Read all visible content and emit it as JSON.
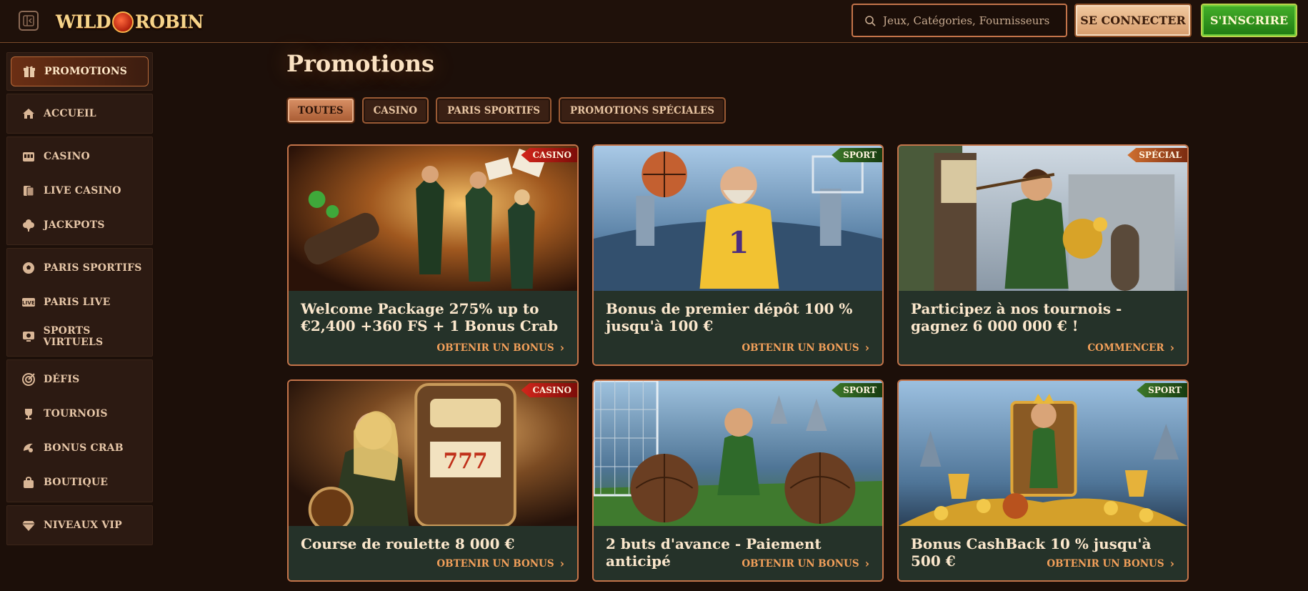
{
  "header": {
    "logo_left": "WILD",
    "logo_right": "ROBIN",
    "search_placeholder": "Jeux, Catégories, Fournisseurs",
    "login_label": "SE CONNECTER",
    "register_label": "S'INSCRIRE"
  },
  "sidebar": {
    "groups": [
      [
        {
          "label": "PROMOTIONS",
          "icon": "gift-icon",
          "active": true
        }
      ],
      [
        {
          "label": "ACCUEIL",
          "icon": "home-icon"
        }
      ],
      [
        {
          "label": "CASINO",
          "icon": "slot-machine-icon"
        },
        {
          "label": "LIVE CASINO",
          "icon": "cards-icon"
        },
        {
          "label": "JACKPOTS",
          "icon": "clover-icon"
        }
      ],
      [
        {
          "label": "PARIS SPORTIFS",
          "icon": "football-icon"
        },
        {
          "label": "PARIS LIVE",
          "icon": "live-icon"
        },
        {
          "label": "SPORTS VIRTUELS",
          "icon": "virtual-sports-icon"
        }
      ],
      [
        {
          "label": "DÉFIS",
          "icon": "target-icon"
        },
        {
          "label": "TOURNOIS",
          "icon": "trophy-icon"
        },
        {
          "label": "BONUS CRAB",
          "icon": "crab-icon"
        },
        {
          "label": "BOUTIQUE",
          "icon": "shopping-bag-icon"
        }
      ],
      [
        {
          "label": "NIVEAUX VIP",
          "icon": "diamond-icon"
        }
      ]
    ]
  },
  "main": {
    "title": "Promotions",
    "filters": [
      {
        "label": "TOUTES",
        "active": true
      },
      {
        "label": "CASINO"
      },
      {
        "label": "PARIS SPORTIFS"
      },
      {
        "label": "PROMOTIONS SPÉCIALES"
      }
    ],
    "cards": [
      {
        "badge": "CASINO",
        "badge_type": "casino",
        "title": "Welcome Package 275% up to €2,400 +360 FS + 1 Bonus Crab",
        "cta": "OBTENIR UN BONUS",
        "scene": "casino-heroes"
      },
      {
        "badge": "SPORT",
        "badge_type": "sport",
        "title": "Bonus de premier dépôt 100 % jusqu'à 100 €",
        "cta": "OBTENIR UN BONUS",
        "scene": "basketball"
      },
      {
        "badge": "SPÉCIAL",
        "badge_type": "special",
        "title": "Participez à nos tournois - gagnez 6 000 000 € !",
        "cta": "COMMENCER",
        "scene": "archer-castle"
      },
      {
        "badge": "CASINO",
        "badge_type": "casino",
        "title": "Course de roulette 8 000 €",
        "cta": "OBTENIR UN BONUS",
        "scene": "slot-machine"
      },
      {
        "badge": "SPORT",
        "badge_type": "sport",
        "title": "2 buts d'avance - Paiement anticipé",
        "cta": "OBTENIR UN BONUS",
        "scene": "football-goal"
      },
      {
        "badge": "SPORT",
        "badge_type": "sport",
        "title": "Bonus CashBack 10 % jusqu'à 500 €",
        "cta": "OBTENIR UN BONUS",
        "scene": "throne-gold"
      }
    ]
  },
  "colors": {
    "background": "#1c0f09",
    "accent": "#c4744a",
    "cta": "#f3a05a",
    "register": "#2f9a1f"
  }
}
